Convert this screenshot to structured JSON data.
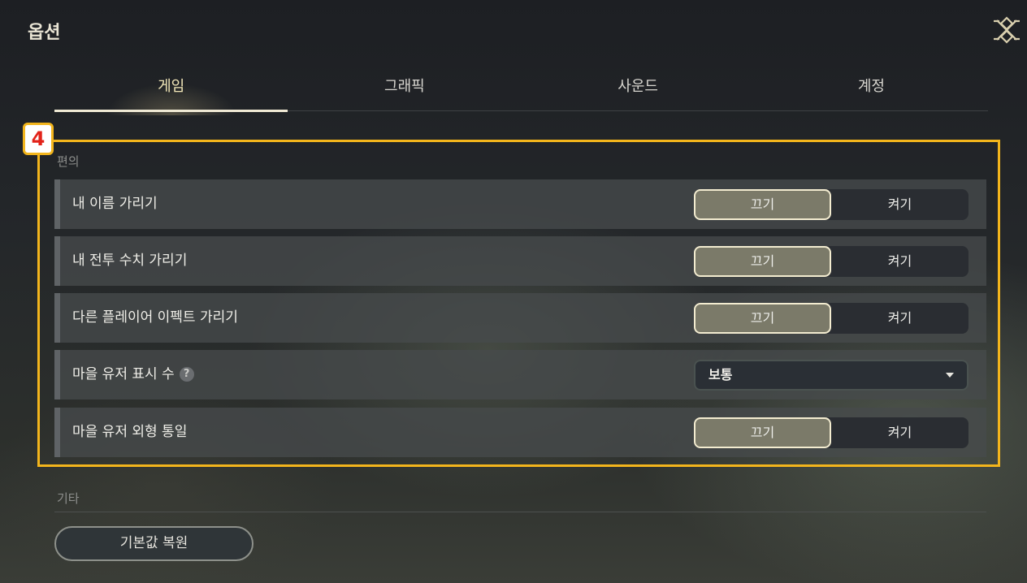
{
  "title": "옵션",
  "close_icon": "close-emblem-icon",
  "tabs": [
    {
      "label": "게임",
      "active": true
    },
    {
      "label": "그래픽",
      "active": false
    },
    {
      "label": "사운드",
      "active": false
    },
    {
      "label": "계정",
      "active": false
    }
  ],
  "annotation_badge": "4",
  "convenience": {
    "section_label": "편의",
    "rows": [
      {
        "label": "내 이름 가리기",
        "off": "끄기",
        "on": "켜기",
        "selected": "off"
      },
      {
        "label": "내 전투 수치 가리기",
        "off": "끄기",
        "on": "켜기",
        "selected": "off"
      },
      {
        "label": "다른 플레이어 이펙트 가리기",
        "off": "끄기",
        "on": "켜기",
        "selected": "off"
      },
      {
        "label": "마을 유저 표시 수",
        "help": "?",
        "select_value": "보통"
      },
      {
        "label": "마을 유저 외형 통일",
        "off": "끄기",
        "on": "켜기",
        "selected": "off"
      }
    ]
  },
  "etc": {
    "section_label": "기타",
    "reset_label": "기본값 복원"
  },
  "colors": {
    "highlight": "#f3b51c",
    "active_tab_text": "#f1e6b8",
    "toggle_selected": "#7b7a69"
  }
}
